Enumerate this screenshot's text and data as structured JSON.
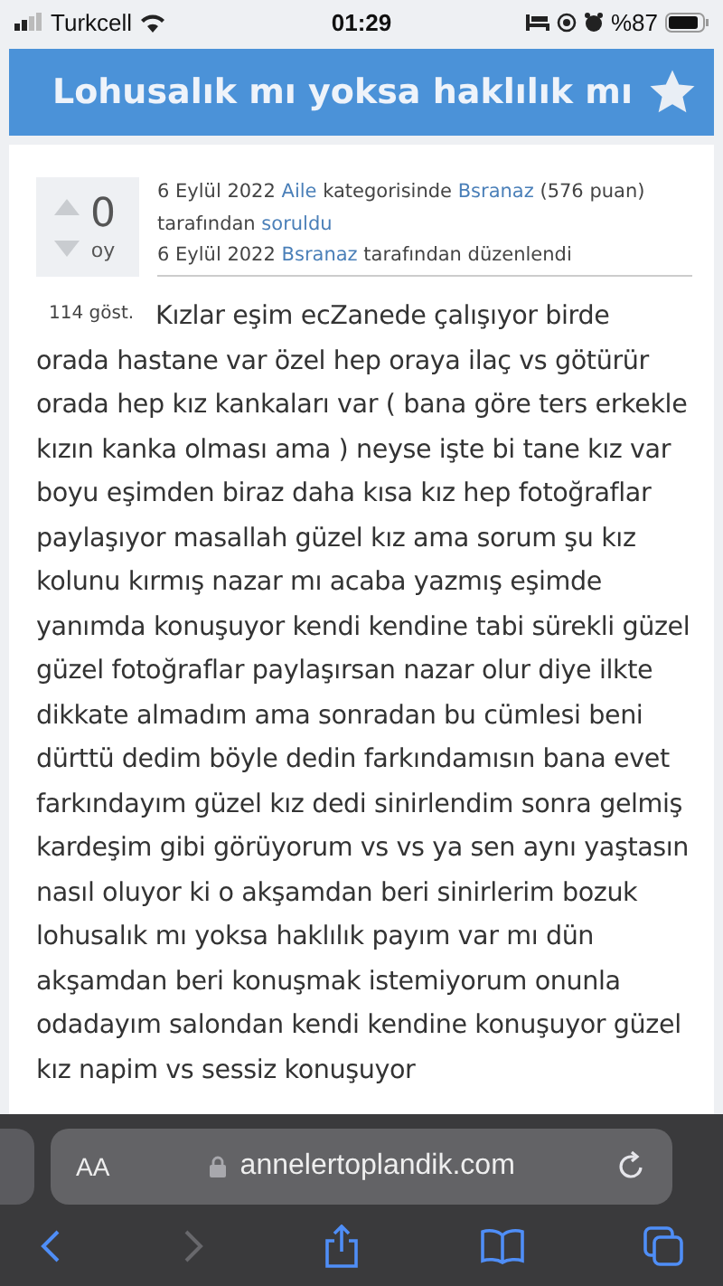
{
  "status_bar": {
    "carrier": "Turkcell",
    "time": "01:29",
    "battery": "%87"
  },
  "title": "Lohusalık mı yoksa haklılık mı",
  "favorite": {
    "selected": false
  },
  "vote": {
    "count": "0",
    "unit": "oy"
  },
  "meta": {
    "date1": "6 Eylül 2022",
    "category": "Aile",
    "text1": "kategorisinde",
    "user1": "Bsranaz",
    "points": "(576 puan)",
    "text2": "tarafından",
    "action": "soruldu",
    "date2": "6 Eylül 2022",
    "user2": "Bsranaz",
    "text3": "tarafından düzenlendi"
  },
  "views": "114 göst.",
  "body_lines": [
    "Kızlar eşim ecZanede çalışıyor birde",
    "orada hastane var özel hep oraya ilaç vs götürür",
    "orada hep kız kankaları var ( bana göre ters erkekle",
    "kızın kanka olması ama ) neyse işte bi tane kız var",
    "boyu eşimden biraz daha kısa kız hep fotoğraflar",
    "paylaşıyor masallah güzel kız ama sorum şu kız",
    "kolunu kırmış nazar mı acaba yazmış eşimde",
    "yanımda konuşuyor kendi kendine tabi sürekli güzel",
    "güzel fotoğraflar paylaşırsan nazar olur diye ilkte",
    "dikkate almadım ama sonradan bu cümlesi beni",
    "dürttü dedim böyle dedin farkındamısın bana evet",
    "farkındayım güzel kız dedi sinirlendim sonra gelmiş",
    "kardeşim gibi görüyorum vs vs ya sen aynı yaştasın",
    "nasıl oluyor ki o akşamdan beri sinirlerim bozuk",
    "lohusalık mı yoksa haklılık payım var mı dün",
    "akşamdan beri konuşmak istemiyorum onunla",
    "odadayım salondan kendi kendine konuşuyor güzel",
    "kız napim vs sessiz konuşuyor"
  ],
  "browser": {
    "text_size": "AA",
    "url": "annelertoplandik.com"
  }
}
